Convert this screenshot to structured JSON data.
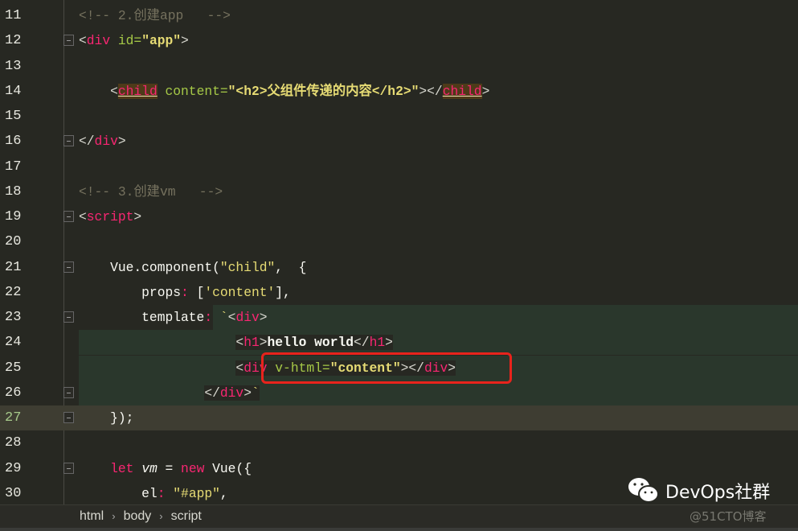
{
  "lines": [
    {
      "n": "11",
      "fold": false,
      "tokens": [
        [
          "<!-- 2.创建app   -->",
          "cm"
        ]
      ]
    },
    {
      "n": "12",
      "fold": true,
      "tokens": [
        [
          "<",
          "punct"
        ],
        [
          "div",
          "tag"
        ],
        [
          " id=",
          "attr"
        ],
        [
          "\"app\"",
          "strb"
        ],
        [
          ">",
          "punct"
        ]
      ]
    },
    {
      "n": "13",
      "fold": false,
      "tokens": []
    },
    {
      "n": "14",
      "fold": false,
      "tokens": [
        [
          "    <",
          "punct"
        ],
        [
          "child",
          "child"
        ],
        [
          " content=",
          "attr"
        ],
        [
          "\"<h2>父组件传递的内容</h2>\"",
          "strb"
        ],
        [
          "></",
          "punct"
        ],
        [
          "child",
          "child"
        ],
        [
          ">",
          "punct"
        ]
      ]
    },
    {
      "n": "15",
      "fold": false,
      "tokens": []
    },
    {
      "n": "16",
      "fold": true,
      "tokens": [
        [
          "</",
          "punct"
        ],
        [
          "div",
          "tag"
        ],
        [
          ">",
          "punct"
        ]
      ]
    },
    {
      "n": "17",
      "fold": false,
      "tokens": []
    },
    {
      "n": "18",
      "fold": false,
      "tokens": [
        [
          "<!-- 3.创建vm   -->",
          "cm"
        ]
      ]
    },
    {
      "n": "19",
      "fold": true,
      "tokens": [
        [
          "<",
          "punct"
        ],
        [
          "script",
          "tag"
        ],
        [
          ">",
          "punct"
        ]
      ]
    },
    {
      "n": "20",
      "fold": false,
      "tokens": []
    },
    {
      "n": "21",
      "fold": true,
      "tokens": [
        [
          "    Vue.component(",
          "txt"
        ],
        [
          "\"child\"",
          "str"
        ],
        [
          ",  {",
          "txt"
        ]
      ]
    },
    {
      "n": "22",
      "fold": false,
      "tokens": [
        [
          "        props",
          "txt"
        ],
        [
          ":",
          "kw"
        ],
        [
          " [",
          "txt"
        ],
        [
          "'content'",
          "str"
        ],
        [
          "],",
          "txt"
        ]
      ]
    },
    {
      "n": "23",
      "fold": true,
      "tokens": [
        [
          "        template",
          "txt"
        ],
        [
          ":",
          "kw"
        ],
        [
          " `",
          "str"
        ],
        [
          "<",
          "punct"
        ],
        [
          "div",
          "tag"
        ],
        [
          ">",
          "punct"
        ]
      ]
    },
    {
      "n": "24",
      "fold": false,
      "tokens": [
        [
          "                    ",
          "txt"
        ],
        [
          "<",
          "punct"
        ],
        [
          "h1",
          "tag"
        ],
        [
          ">",
          "punct"
        ],
        [
          "hello world",
          "txtb"
        ],
        [
          "</",
          "punct"
        ],
        [
          "h1",
          "tag"
        ],
        [
          ">",
          "punct"
        ]
      ]
    },
    {
      "n": "25",
      "fold": false,
      "tokens": [
        [
          "                    ",
          "txt"
        ],
        [
          "<",
          "punct"
        ],
        [
          "div",
          "tag"
        ],
        [
          " v-html=",
          "attr"
        ],
        [
          "\"content\"",
          "strb"
        ],
        [
          "></",
          "punct"
        ],
        [
          "div",
          "tag"
        ],
        [
          ">",
          "punct"
        ]
      ]
    },
    {
      "n": "26",
      "fold": true,
      "tokens": [
        [
          "                ",
          "txt"
        ],
        [
          "</",
          "punct"
        ],
        [
          "div",
          "tag"
        ],
        [
          ">",
          "punct"
        ],
        [
          "`",
          "str"
        ]
      ]
    },
    {
      "n": "27",
      "fold": true,
      "current": true,
      "tokens": [
        [
          "    });",
          "txt"
        ]
      ]
    },
    {
      "n": "28",
      "fold": false,
      "tokens": []
    },
    {
      "n": "29",
      "fold": true,
      "tokens": [
        [
          "    ",
          "txt"
        ],
        [
          "let",
          "kw"
        ],
        [
          " ",
          "txt"
        ],
        [
          "vm",
          "it"
        ],
        [
          " = ",
          "txt"
        ],
        [
          "new",
          "kw"
        ],
        [
          " Vue({",
          "txt"
        ]
      ]
    },
    {
      "n": "30",
      "fold": false,
      "tokens": [
        [
          "        el",
          "txt"
        ],
        [
          ":",
          "kw"
        ],
        [
          " ",
          "txt"
        ],
        [
          "\"#app\"",
          "str"
        ],
        [
          ",",
          "txt"
        ]
      ]
    }
  ],
  "breadcrumb": [
    "html",
    "body",
    "script"
  ],
  "watermark": {
    "brand": "DevOps社群",
    "source": "@51CTO博客"
  },
  "colors": {
    "background": "#272822",
    "tag": "#f92672",
    "attribute": "#a6c947",
    "string": "#e6db74",
    "comment": "#75715e",
    "highlight_box": "#e8231c"
  }
}
